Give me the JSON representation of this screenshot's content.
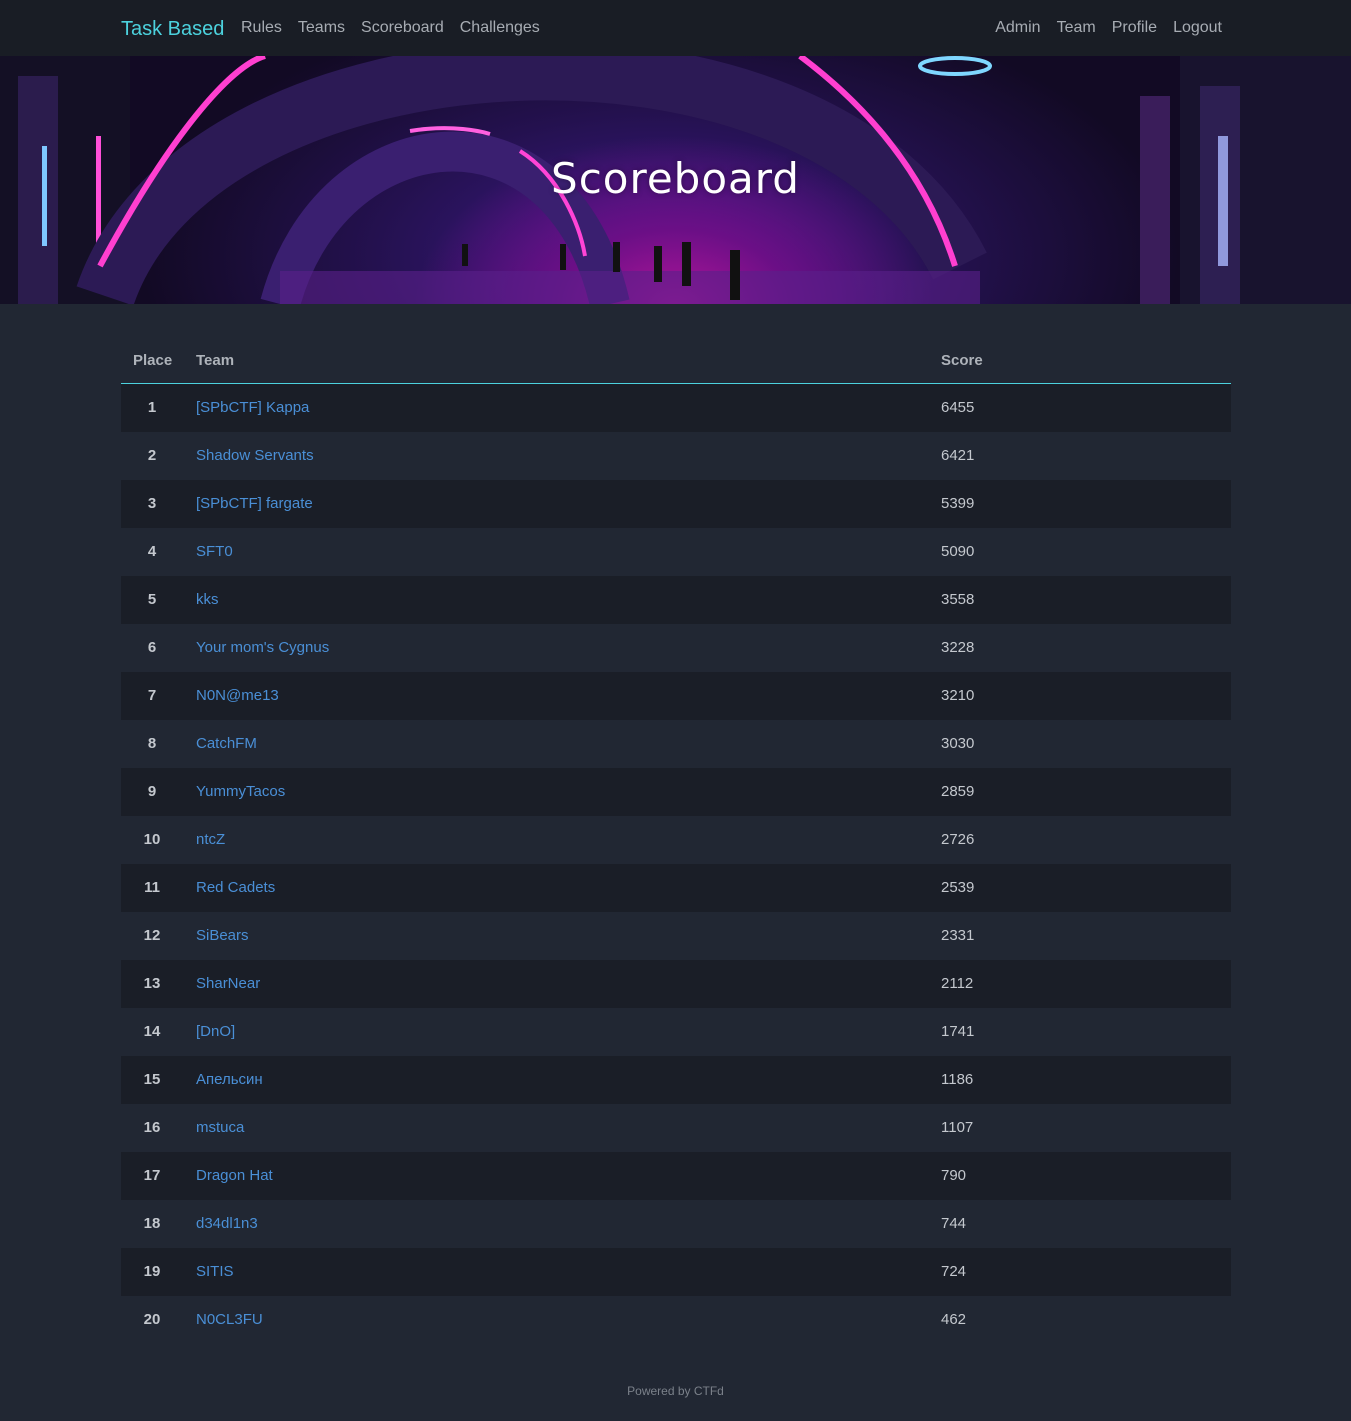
{
  "nav": {
    "brand": "Task Based",
    "left": [
      "Rules",
      "Teams",
      "Scoreboard",
      "Challenges"
    ],
    "right": [
      "Admin",
      "Team",
      "Profile",
      "Logout"
    ]
  },
  "hero": {
    "title": "Scoreboard"
  },
  "table": {
    "headers": {
      "place": "Place",
      "team": "Team",
      "score": "Score"
    },
    "rows": [
      {
        "place": "1",
        "team": "[SPbCTF] Kappa",
        "score": "6455"
      },
      {
        "place": "2",
        "team": "Shadow Servants",
        "score": "6421"
      },
      {
        "place": "3",
        "team": "[SPbCTF] fargate",
        "score": "5399"
      },
      {
        "place": "4",
        "team": "SFT0",
        "score": "5090"
      },
      {
        "place": "5",
        "team": "kks",
        "score": "3558"
      },
      {
        "place": "6",
        "team": "Your mom's Cygnus",
        "score": "3228"
      },
      {
        "place": "7",
        "team": "N0N@me13",
        "score": "3210"
      },
      {
        "place": "8",
        "team": "CatchFM",
        "score": "3030"
      },
      {
        "place": "9",
        "team": "YummyTacos",
        "score": "2859"
      },
      {
        "place": "10",
        "team": "ntcZ",
        "score": "2726"
      },
      {
        "place": "11",
        "team": "Red Cadets",
        "score": "2539"
      },
      {
        "place": "12",
        "team": "SiBears",
        "score": "2331"
      },
      {
        "place": "13",
        "team": "SharNear",
        "score": "2112"
      },
      {
        "place": "14",
        "team": "[DnO]",
        "score": "1741"
      },
      {
        "place": "15",
        "team": "Апельсин",
        "score": "1186"
      },
      {
        "place": "16",
        "team": "mstuca",
        "score": "1107"
      },
      {
        "place": "17",
        "team": "Dragon Hat",
        "score": "790"
      },
      {
        "place": "18",
        "team": "d34dl1n3",
        "score": "744"
      },
      {
        "place": "19",
        "team": "SITIS",
        "score": "724"
      },
      {
        "place": "20",
        "team": "N0CL3FU",
        "score": "462"
      }
    ]
  },
  "footer": {
    "text": "Powered by CTFd"
  }
}
